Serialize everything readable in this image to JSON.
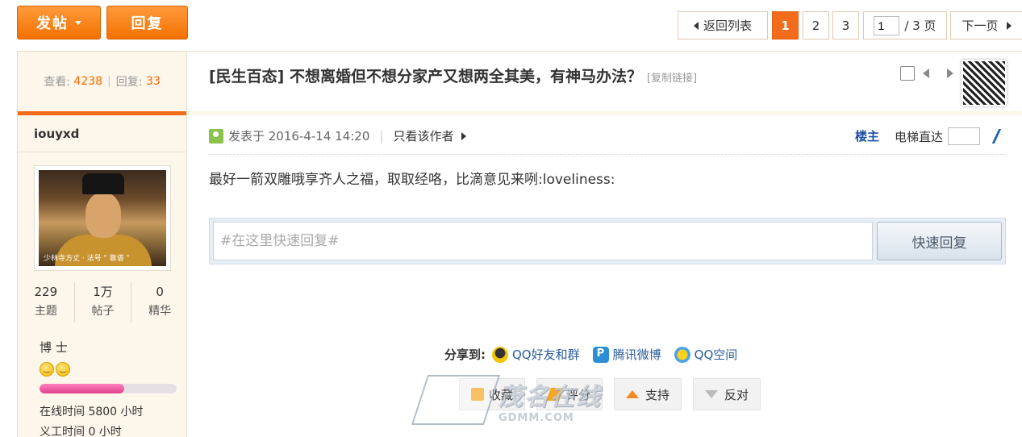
{
  "toolbar": {
    "post_label": "发帖",
    "reply_label": "回复"
  },
  "pagination": {
    "back_label": "返回列表",
    "pages": [
      "1",
      "2",
      "3"
    ],
    "current_page": "1",
    "page_input_value": "1",
    "total_label": "/ 3 页",
    "next_label": "下一页"
  },
  "thread_stats": {
    "views_label": "查看:",
    "views": "4238",
    "replies_label": "回复:",
    "replies": "33"
  },
  "author": {
    "name": "iouyxd",
    "avatar_caption": "少林寺方丈 · 法号 \" 靠谱 \"",
    "stats": [
      {
        "value": "229",
        "label": "主题"
      },
      {
        "value": "1万",
        "label": "帖子"
      },
      {
        "value": "0",
        "label": "精华"
      }
    ],
    "rank": "博 士",
    "rank_progress": 0.62,
    "online_time": "在线时间   5800 小时",
    "volunteer_time": "义工时间   0 小时"
  },
  "thread": {
    "title": "[民生百态] 不想离婚但不想分家产又想两全其美，有神马办法？",
    "copy_link": "[复制链接]"
  },
  "post": {
    "posted_at": "发表于 2016-4-14 14:20",
    "only_author": "只看该作者",
    "floor": "楼主",
    "lift_label": "电梯直达",
    "body": "最好一箭双雕哦享齐人之福，取取经咯，比滴意见来咧:loveliness:"
  },
  "quick_reply": {
    "placeholder": "#在这里快速回复#",
    "button": "快速回复"
  },
  "share": {
    "label": "分享到:",
    "items": [
      "QQ好友和群",
      "腾讯微博",
      "QQ空间"
    ]
  },
  "actions": {
    "favorite": "收藏",
    "rate": "评分",
    "support": "支持",
    "oppose": "反对"
  },
  "watermark": {
    "cn": "茂名在线",
    "en": "GDMM.COM"
  },
  "colors": {
    "accent": "#f26c1b",
    "sidebar_bg": "#fdf6ea",
    "link": "#2a5d9c"
  }
}
